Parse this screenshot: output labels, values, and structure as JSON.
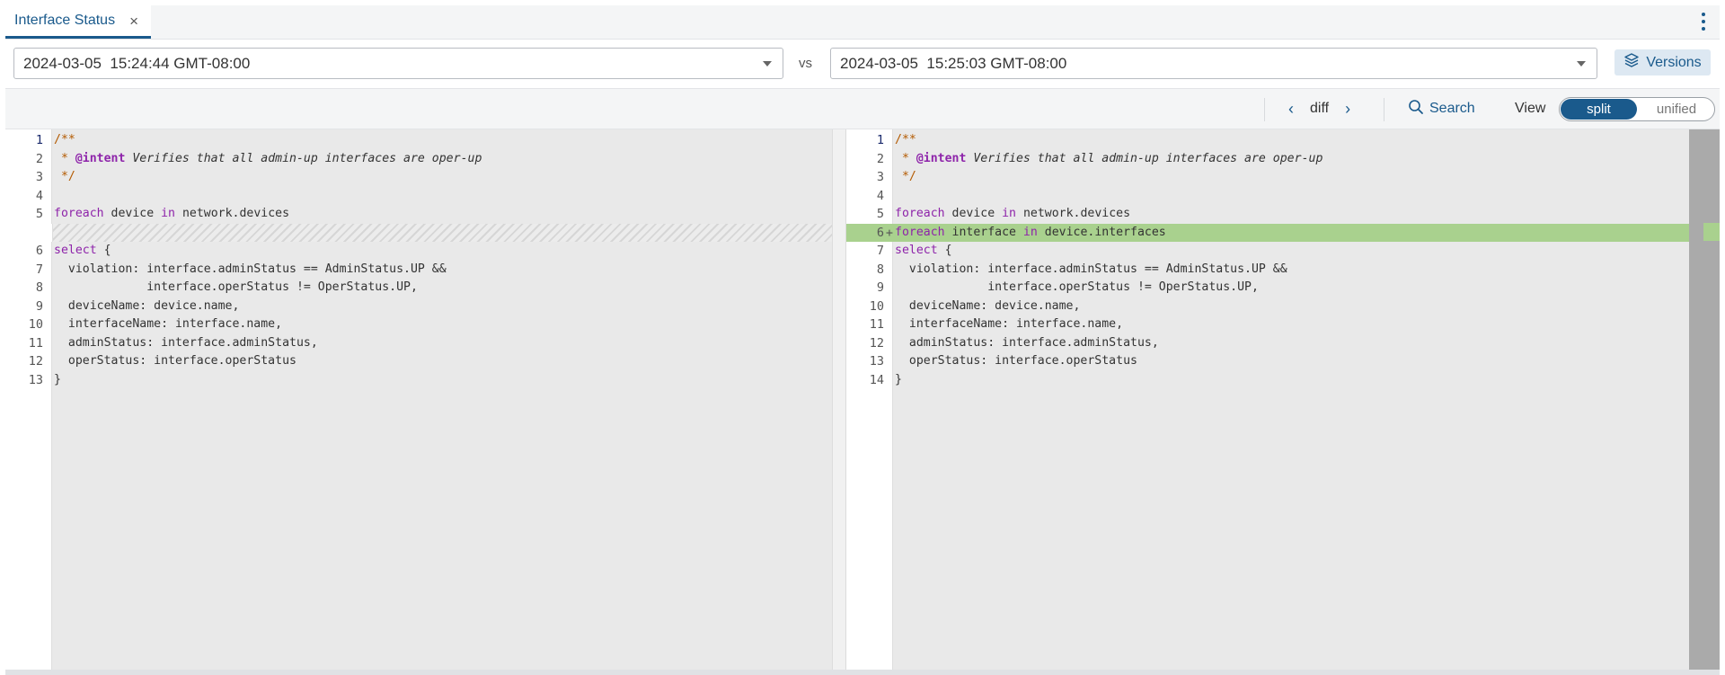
{
  "tab": {
    "label": "Interface Status",
    "close_glyph": "×",
    "close_icon": "close-icon"
  },
  "menu": {
    "icon": "kebab-menu-icon"
  },
  "compare": {
    "left_version": "2024-03-05  15:24:44 GMT-08:00",
    "vs_label": "vs",
    "right_version": "2024-03-05  15:25:03 GMT-08:00"
  },
  "versions_button": {
    "label": "Versions",
    "icon": "layers-icon"
  },
  "toolbar": {
    "prev_glyph": "‹",
    "diff_label": "diff",
    "next_glyph": "›",
    "search_label": "Search",
    "view_label": "View",
    "view_options": {
      "split": "split",
      "unified": "unified"
    },
    "selected_view": "split"
  },
  "colors": {
    "accent": "#1a5a8c",
    "added_line": "#a9d18e",
    "keyword": "#8e24aa",
    "comment": "#b35a00"
  },
  "left_code": [
    {
      "n": "1",
      "tokens": [
        [
          "cm",
          "/**"
        ]
      ]
    },
    {
      "n": "2",
      "tokens": [
        [
          "cm",
          " * "
        ],
        [
          "tag",
          "@intent"
        ],
        [
          "it",
          " Verifies that all admin-up interfaces are oper-up"
        ]
      ]
    },
    {
      "n": "3",
      "tokens": [
        [
          "cm",
          " */"
        ]
      ]
    },
    {
      "n": "4",
      "tokens": []
    },
    {
      "n": "5",
      "tokens": [
        [
          "kw",
          "foreach"
        ],
        [
          "",
          " device "
        ],
        [
          "kw",
          "in"
        ],
        [
          "",
          " network.devices"
        ]
      ]
    },
    {
      "n": "",
      "placeholder": true,
      "tokens": []
    },
    {
      "n": "6",
      "tokens": [
        [
          "kw",
          "select"
        ],
        [
          "",
          " {"
        ]
      ]
    },
    {
      "n": "7",
      "tokens": [
        [
          "",
          "  violation: interface.adminStatus == AdminStatus.UP &&"
        ]
      ]
    },
    {
      "n": "8",
      "tokens": [
        [
          "",
          "             interface.operStatus != OperStatus.UP,"
        ]
      ]
    },
    {
      "n": "9",
      "tokens": [
        [
          "",
          "  deviceName: device.name,"
        ]
      ]
    },
    {
      "n": "10",
      "tokens": [
        [
          "",
          "  interfaceName: interface.name,"
        ]
      ]
    },
    {
      "n": "11",
      "tokens": [
        [
          "",
          "  adminStatus: interface.adminStatus,"
        ]
      ]
    },
    {
      "n": "12",
      "tokens": [
        [
          "",
          "  operStatus: interface.operStatus"
        ]
      ]
    },
    {
      "n": "13",
      "tokens": [
        [
          "",
          "}"
        ]
      ]
    }
  ],
  "right_code": [
    {
      "n": "1",
      "tokens": [
        [
          "cm",
          "/**"
        ]
      ]
    },
    {
      "n": "2",
      "tokens": [
        [
          "cm",
          " * "
        ],
        [
          "tag",
          "@intent"
        ],
        [
          "it",
          " Verifies that all admin-up interfaces are oper-up"
        ]
      ]
    },
    {
      "n": "3",
      "tokens": [
        [
          "cm",
          " */"
        ]
      ]
    },
    {
      "n": "4",
      "tokens": []
    },
    {
      "n": "5",
      "tokens": [
        [
          "kw",
          "foreach"
        ],
        [
          "",
          " device "
        ],
        [
          "kw",
          "in"
        ],
        [
          "",
          " network.devices"
        ]
      ]
    },
    {
      "n": "6",
      "added": true,
      "tokens": [
        [
          "kw",
          "foreach"
        ],
        [
          "",
          " interface "
        ],
        [
          "kw",
          "in"
        ],
        [
          "",
          " device.interfaces"
        ]
      ]
    },
    {
      "n": "7",
      "tokens": [
        [
          "kw",
          "select"
        ],
        [
          "",
          " {"
        ]
      ]
    },
    {
      "n": "8",
      "tokens": [
        [
          "",
          "  violation: interface.adminStatus == AdminStatus.UP &&"
        ]
      ]
    },
    {
      "n": "9",
      "tokens": [
        [
          "",
          "             interface.operStatus != OperStatus.UP,"
        ]
      ]
    },
    {
      "n": "10",
      "tokens": [
        [
          "",
          "  deviceName: device.name,"
        ]
      ]
    },
    {
      "n": "11",
      "tokens": [
        [
          "",
          "  interfaceName: interface.name,"
        ]
      ]
    },
    {
      "n": "12",
      "tokens": [
        [
          "",
          "  adminStatus: interface.adminStatus,"
        ]
      ]
    },
    {
      "n": "13",
      "tokens": [
        [
          "",
          "  operStatus: interface.operStatus"
        ]
      ]
    },
    {
      "n": "14",
      "tokens": [
        [
          "",
          "}"
        ]
      ]
    }
  ]
}
